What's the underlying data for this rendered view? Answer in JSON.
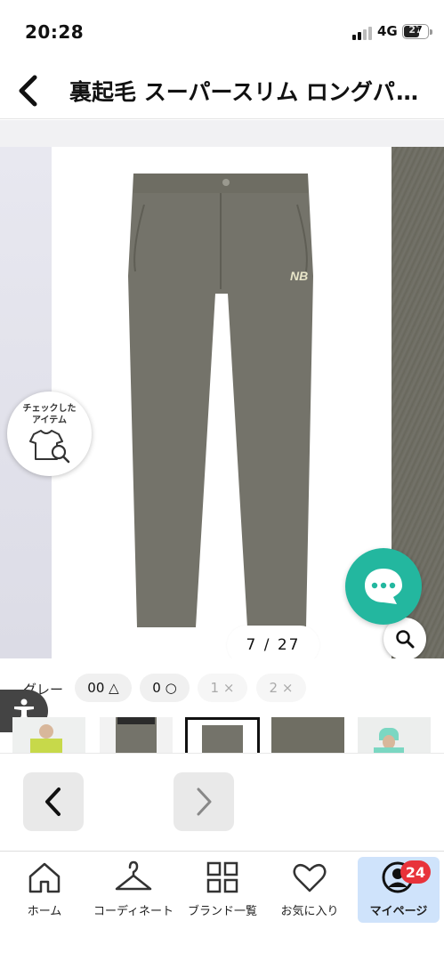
{
  "status_bar": {
    "time": "20:28",
    "network": "4G",
    "battery": "27"
  },
  "header": {
    "title": "裏起毛 スーパースリム ロングパンツ"
  },
  "gallery": {
    "counter": "7 / 27",
    "checked_items_label": "チェックした\nアイテム"
  },
  "variants": {
    "color_label": "グレー",
    "sizes": [
      {
        "label": "00 △",
        "available": true
      },
      {
        "label": "0 ○",
        "available": true
      },
      {
        "label": "1 ×",
        "available": false
      },
      {
        "label": "2 ×",
        "available": false
      }
    ]
  },
  "bottom_nav": {
    "items": [
      {
        "label": "ホーム",
        "icon": "home-icon"
      },
      {
        "label": "コーディネート",
        "icon": "hanger-icon"
      },
      {
        "label": "ブランド一覧",
        "icon": "grid-icon"
      },
      {
        "label": "お気に入り",
        "icon": "heart-icon"
      },
      {
        "label": "マイページ",
        "icon": "user-icon",
        "badge": "24",
        "active": true
      }
    ]
  },
  "colors": {
    "accent_chat": "#23b79f",
    "nav_active_bg": "#cfe3fb",
    "badge": "#e8333b",
    "product": "#74736a"
  }
}
